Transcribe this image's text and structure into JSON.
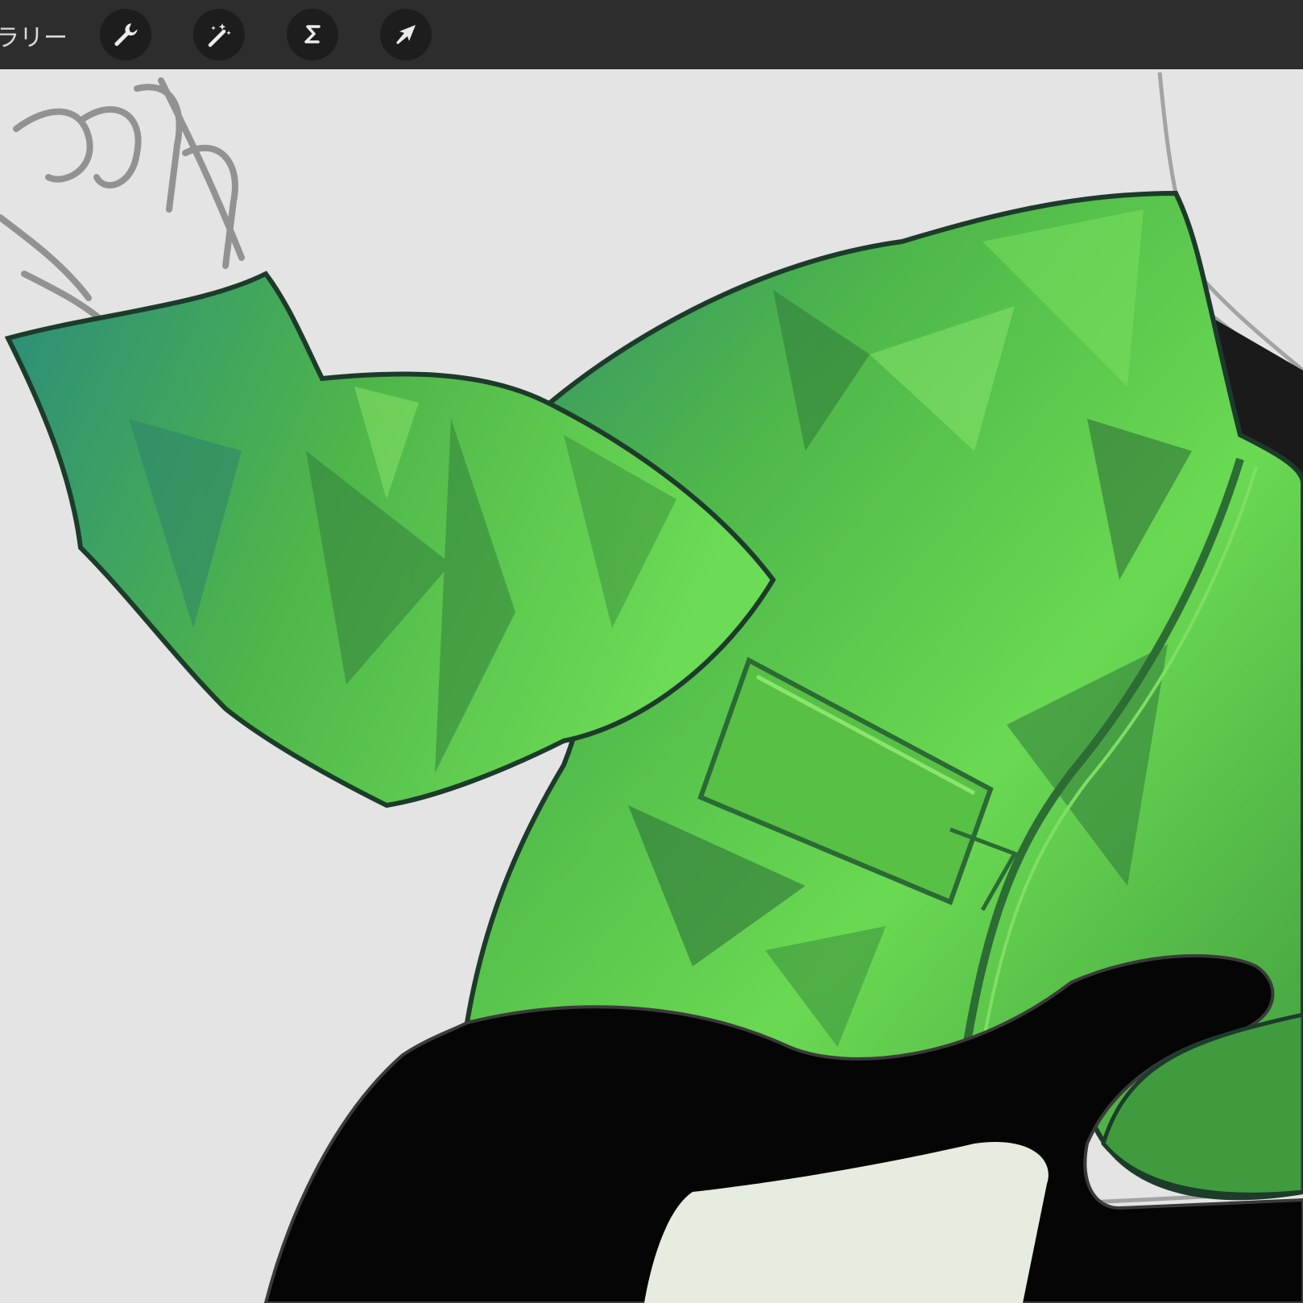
{
  "toolbar": {
    "gallery_label": "ラリー",
    "tools": [
      {
        "name": "actions",
        "icon": "wrench-icon"
      },
      {
        "name": "adjustments",
        "icon": "magic-wand-icon"
      },
      {
        "name": "selection",
        "icon": "selection-s-icon"
      },
      {
        "name": "transform",
        "icon": "arrow-cursor-icon"
      }
    ]
  },
  "canvas": {
    "background_color": "#e4e4e4",
    "artwork": "green-jacket-illustration"
  },
  "colors": {
    "toolbar_bg": "#2d2d2d",
    "button_bg": "#1d1d1d",
    "icon_color": "#e8e8e8",
    "jacket_green": "#5cc443",
    "jacket_dark": "#2f7a3a",
    "jacket_shadow": "#2a5f58"
  }
}
